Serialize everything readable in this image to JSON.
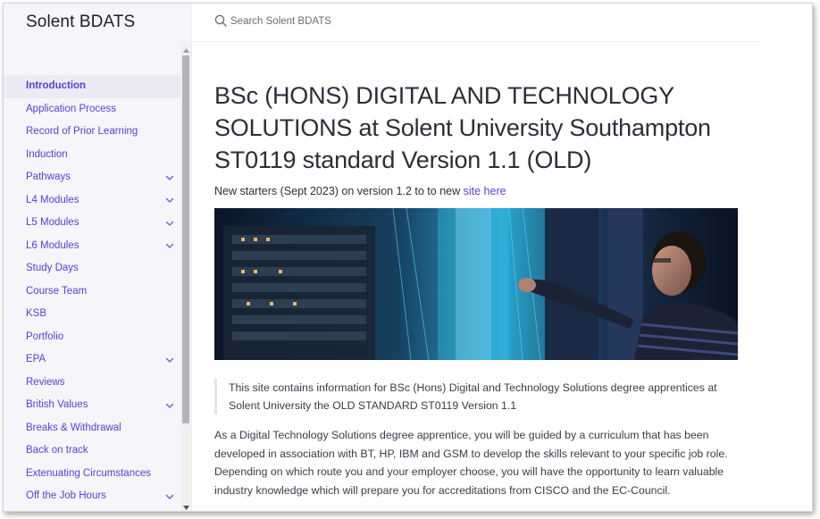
{
  "site": {
    "title": "Solent BDATS"
  },
  "search": {
    "placeholder": "Search Solent BDATS"
  },
  "sidebar": {
    "items": [
      {
        "label": "Introduction",
        "active": true,
        "expandable": false
      },
      {
        "label": "Application Process",
        "active": false,
        "expandable": false
      },
      {
        "label": "Record of Prior Learning",
        "active": false,
        "expandable": false
      },
      {
        "label": "Induction",
        "active": false,
        "expandable": false
      },
      {
        "label": "Pathways",
        "active": false,
        "expandable": true
      },
      {
        "label": "L4 Modules",
        "active": false,
        "expandable": true
      },
      {
        "label": "L5 Modules",
        "active": false,
        "expandable": true
      },
      {
        "label": "L6 Modules",
        "active": false,
        "expandable": true
      },
      {
        "label": "Study Days",
        "active": false,
        "expandable": false
      },
      {
        "label": "Course Team",
        "active": false,
        "expandable": false
      },
      {
        "label": "KSB",
        "active": false,
        "expandable": false
      },
      {
        "label": "Portfolio",
        "active": false,
        "expandable": false
      },
      {
        "label": "EPA",
        "active": false,
        "expandable": true
      },
      {
        "label": "Reviews",
        "active": false,
        "expandable": false
      },
      {
        "label": "British Values",
        "active": false,
        "expandable": true
      },
      {
        "label": "Breaks & Withdrawal",
        "active": false,
        "expandable": false
      },
      {
        "label": "Back on track",
        "active": false,
        "expandable": false
      },
      {
        "label": "Extenuating Circumstances",
        "active": false,
        "expandable": false
      },
      {
        "label": "Off the Job Hours",
        "active": false,
        "expandable": true
      }
    ]
  },
  "main": {
    "title": "BSc (HONS) DIGITAL AND TECHNOLOGY SOLUTIONS at Solent University Southampton ST0119 standard Version 1.1 (OLD)",
    "subtitle_prefix": "New starters (Sept 2023) on version 1.2 to to new ",
    "subtitle_link": "site here",
    "quote": "This site contains information for BSc (Hons) Digital and Technology Solutions degree apprentices at Solent University the OLD STANDARD ST0119 Version 1.1",
    "body": "As a Digital Technology Solutions degree apprentice, you will be guided by a curriculum that has been developed in association with BT, HP, IBM and GSM to develop the skills relevant to your specific job role. Depending on which route you and your employer choose, you will have the opportunity to learn valuable industry knowledge which will prepare you for accreditations from CISCO and the EC-Council."
  },
  "colors": {
    "accent": "#5a3fd6",
    "sidebar_bg": "#f5f5fa",
    "active_bg": "#ebebf4",
    "text": "#3b3b4a"
  },
  "icons": {
    "search": "search-icon",
    "chevron": "chevron-down-icon"
  }
}
